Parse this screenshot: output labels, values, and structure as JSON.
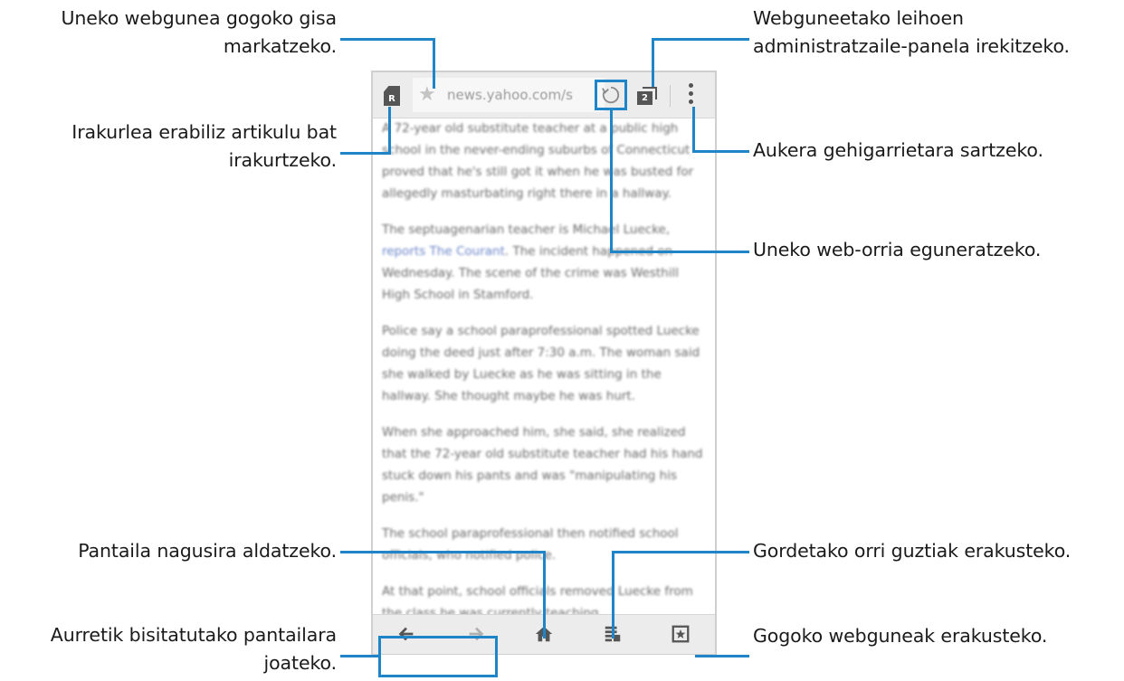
{
  "callouts": {
    "bookmark": [
      "Uneko webgunea gogoko gisa",
      "markatzeko."
    ],
    "reader": [
      "Irakurlea erabiliz artikulu bat",
      "irakurtzeko."
    ],
    "home": "Pantaila nagusira aldatzeko.",
    "history": [
      "Aurretik bisitatutako pantailara",
      "joateko."
    ],
    "tabs": [
      "Webguneetako leihoen",
      "administratzaile-panela irekitzeko."
    ],
    "more": "Aukera gehigarrietara sartzeko.",
    "refresh": "Uneko web-orria eguneratzeko.",
    "saved": "Gordetako orri guztiak erakusteko.",
    "favorites": "Gogoko webguneak erakusteko."
  },
  "browser": {
    "url": "news.yahoo.com/s",
    "tab_count": "2",
    "reader_badge": "R"
  },
  "article": {
    "p1": "A 72-year old substitute teacher at a public high school in the never-ending suburbs of Connecticut proved that he's still got it when he was busted for allegedly masturbating right there in a hallway.",
    "p2_a": "The septuagenarian teacher is Michael Luecke, ",
    "p2_link": "reports The Courant",
    "p2_b": ". The incident happened on Wednesday. The scene of the crime was Westhill High School in Stamford.",
    "p3": "Police say a school paraprofessional spotted Luecke doing the deed just after 7:30 a.m. The woman said she walked by Luecke as he was sitting in the hallway. She thought maybe he was hurt.",
    "p4": "When she approached him, she said, she realized that the 72-year old substitute teacher had his hand stuck down his pants and was \"manipulating his penis.\"",
    "p5": "The school paraprofessional then notified school officials, who notified police.",
    "p6": "At that point, school officials removed Luecke from the class he was currently teaching."
  },
  "colors": {
    "accent": "#1e86c8",
    "toolbar": "#ececec"
  }
}
